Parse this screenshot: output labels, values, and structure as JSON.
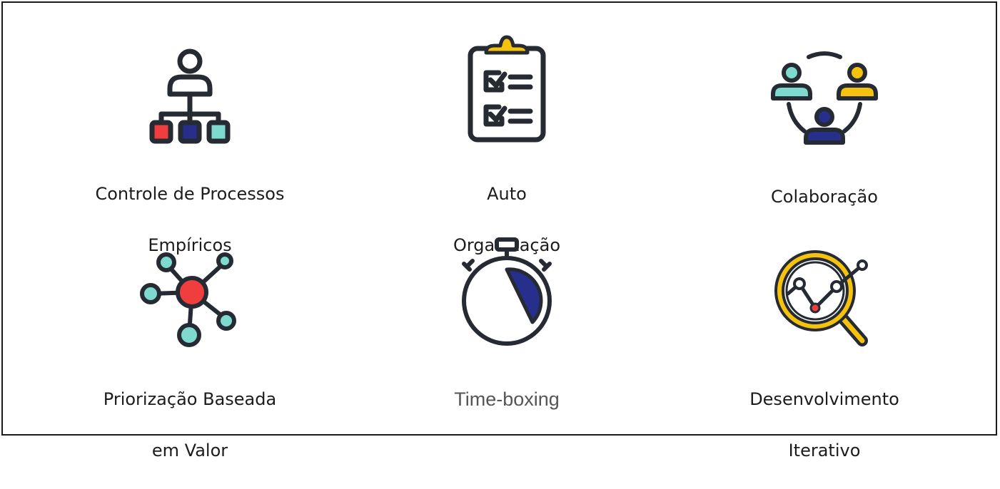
{
  "items": [
    {
      "id": "controle",
      "line1": "Controle de Processos",
      "line2": "Empíricos",
      "icon": "hierarchy-icon"
    },
    {
      "id": "auto",
      "line1": "Auto",
      "line2": "Organização",
      "icon": "clipboard-checklist-icon"
    },
    {
      "id": "colaboracao",
      "line1": "Colaboração",
      "line2": "",
      "icon": "team-collaboration-icon"
    },
    {
      "id": "priorizacao",
      "line1": "Priorização Baseada",
      "line2": "em Valor",
      "icon": "network-nodes-icon"
    },
    {
      "id": "timeboxing",
      "line1": "Time-boxing",
      "line2": "",
      "icon": "stopwatch-icon"
    },
    {
      "id": "desenvolvimento",
      "line1": "Desenvolvimento",
      "line2": "Iterativo",
      "icon": "magnifier-chart-icon"
    }
  ],
  "colors": {
    "outline": "#262a33",
    "red": "#f03d3d",
    "navy": "#262f8c",
    "teal": "#7ed9cf",
    "yellow": "#f5c20e"
  }
}
